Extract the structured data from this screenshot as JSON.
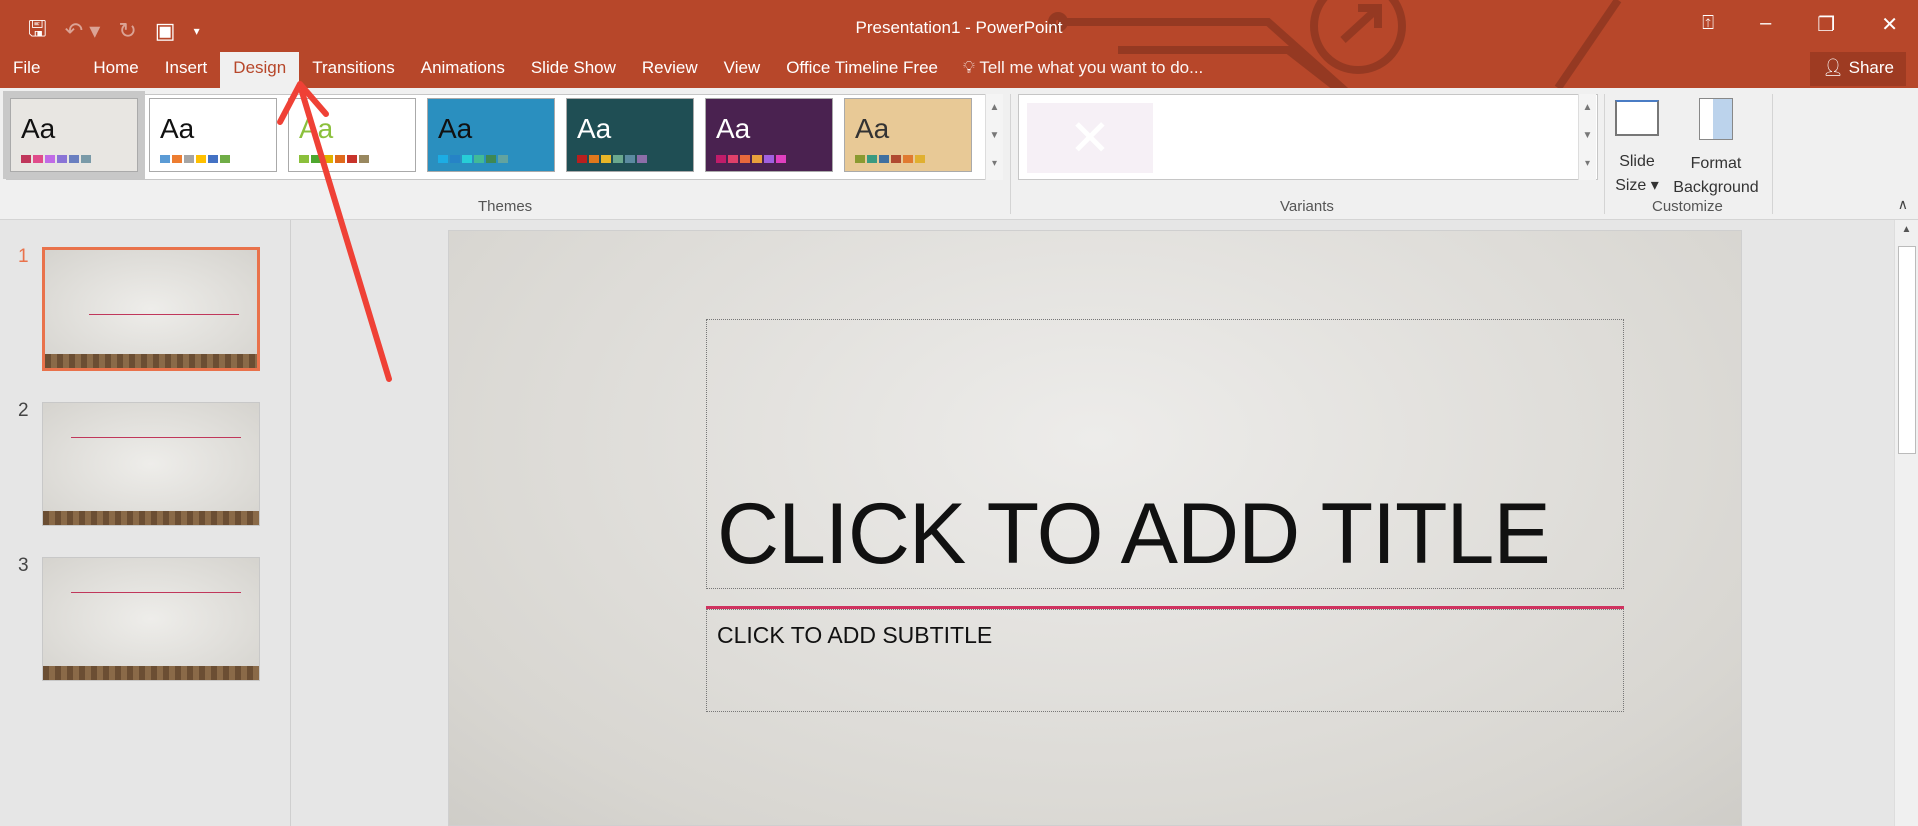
{
  "window": {
    "title": "Presentation1 - PowerPoint"
  },
  "qat": {
    "save": "save-icon",
    "undo": "undo-icon",
    "redo": "redo-icon",
    "present": "present-icon"
  },
  "tabs": [
    "File",
    "Home",
    "Insert",
    "Design",
    "Transitions",
    "Animations",
    "Slide Show",
    "Review",
    "View",
    "Office Timeline Free"
  ],
  "active_tab": "Design",
  "tell_me": "Tell me what you want to do...",
  "share": "Share",
  "ribbon": {
    "themes_label": "Themes",
    "variants_label": "Variants",
    "customize_label": "Customize",
    "slide_size": [
      "Slide",
      "Size"
    ],
    "format_background": [
      "Format",
      "Background"
    ],
    "theme_sample": "Aa"
  },
  "themes": [
    {
      "bg": "#e8e6e2",
      "fg": "#111",
      "sw": [
        "#c0375b",
        "#e04c8a",
        "#c06be6",
        "#8a74d6",
        "#6a7fc0",
        "#7a9aa8"
      ]
    },
    {
      "bg": "#ffffff",
      "fg": "#111",
      "sw": [
        "#5b9bd5",
        "#ed7d31",
        "#a5a5a5",
        "#ffc000",
        "#4472c4",
        "#70ad47"
      ]
    },
    {
      "bg": "#ffffff",
      "fg": "#8bc03c",
      "sw": [
        "#8bc03c",
        "#4ea72e",
        "#e0b000",
        "#e06a1c",
        "#c8342b",
        "#998860"
      ]
    },
    {
      "bg": "#2a8fbf",
      "fg": "#111",
      "sw": [
        "#1cade4",
        "#2683c6",
        "#27ced7",
        "#42ba97",
        "#3e8853",
        "#62a39f"
      ]
    },
    {
      "bg": "#1f4e54",
      "fg": "#fff",
      "sw": [
        "#b81f1f",
        "#e0781c",
        "#e8b628",
        "#6aa88e",
        "#5b8aa0",
        "#8c6ea8"
      ]
    },
    {
      "bg": "#4a2250",
      "fg": "#fff",
      "sw": [
        "#c01c6a",
        "#e0406a",
        "#e8683c",
        "#e8a03c",
        "#a060e0",
        "#e040c0"
      ]
    },
    {
      "bg": "#e8c996",
      "fg": "#333",
      "sw": [
        "#8a9a30",
        "#3a9a80",
        "#4070a0",
        "#b04a30",
        "#e07a30",
        "#e0b030"
      ]
    }
  ],
  "slides": [
    {
      "number": "1"
    },
    {
      "number": "2"
    },
    {
      "number": "3"
    }
  ],
  "slide": {
    "title_placeholder": "CLICK TO ADD TITLE",
    "subtitle_placeholder": "CLICK TO ADD SUBTITLE"
  }
}
